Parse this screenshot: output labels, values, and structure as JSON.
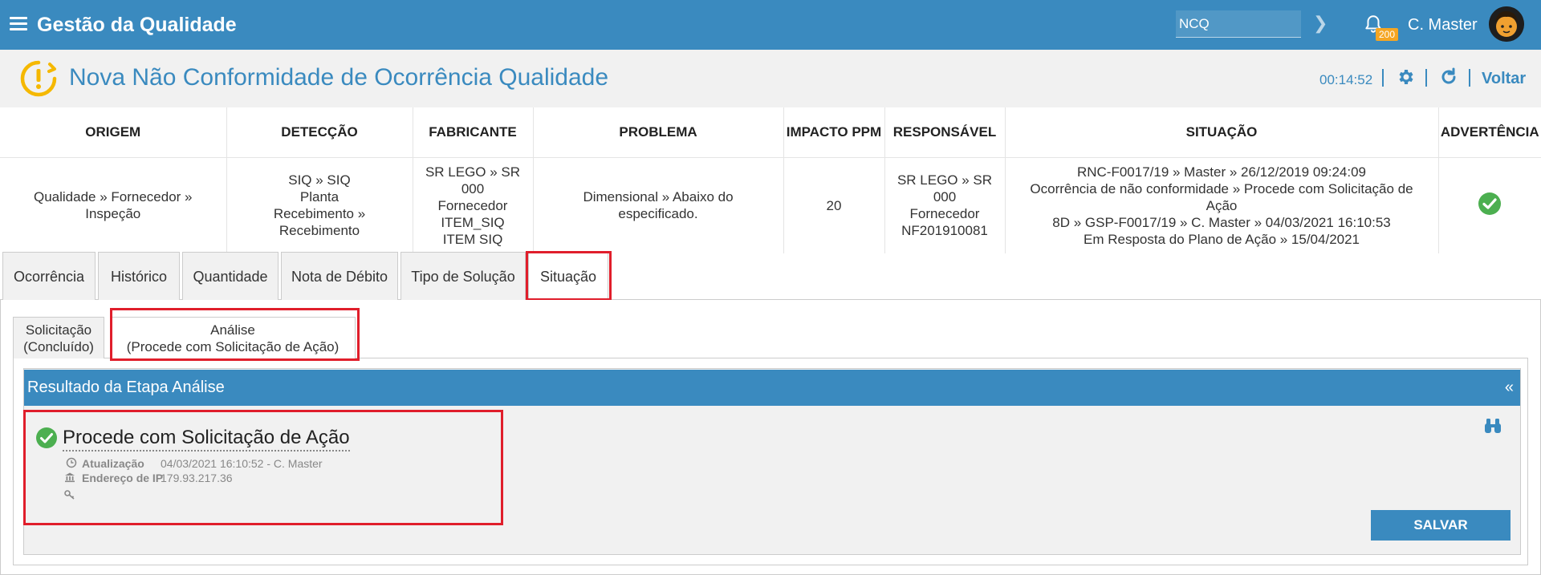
{
  "topbar": {
    "app_title": "Gestão da Qualidade",
    "search_value": "NCQ",
    "notification_count": "200",
    "user_name": "C. Master"
  },
  "page": {
    "title": "Nova Não Conformidade de Ocorrência Qualidade",
    "timer": "00:14:52",
    "back_label": "Voltar"
  },
  "summary": {
    "headers": [
      "ORIGEM",
      "DETECÇÃO",
      "FABRICANTE",
      "PROBLEMA",
      "IMPACTO PPM",
      "RESPONSÁVEL",
      "SITUAÇÃO",
      "ADVERTÊNCIA"
    ],
    "origem": [
      "Qualidade » Fornecedor »",
      "Inspeção"
    ],
    "deteccao": [
      "SIQ » SIQ",
      "Planta",
      "Recebimento »",
      "Recebimento"
    ],
    "fabricante": [
      "SR LEGO » SR",
      "000",
      "Fornecedor",
      "ITEM_SIQ",
      "ITEM SIQ"
    ],
    "problema": [
      "Dimensional » Abaixo do",
      "especificado."
    ],
    "impacto": "20",
    "responsavel": [
      "SR LEGO » SR",
      "000",
      "Fornecedor",
      "NF201910081"
    ],
    "situacao": [
      "RNC-F0017/19 » Master » 26/12/2019 09:24:09",
      "Ocorrência de não conformidade » Procede com Solicitação de",
      "Ação",
      "8D » GSP-F0017/19 » C. Master » 04/03/2021 16:10:53",
      "Em Resposta do Plano de Ação » 15/04/2021"
    ]
  },
  "tabs": [
    "Ocorrência",
    "Histórico",
    "Quantidade",
    "Nota de Débito",
    "Tipo de Solução",
    "Situação"
  ],
  "subtabs": {
    "solicitacao": [
      "Solicitação",
      "(Concluído)"
    ],
    "analise": [
      "Análise",
      "(Procede com Solicitação de Ação)"
    ]
  },
  "panel": {
    "header": "Resultado da Etapa Análise",
    "collapse": "«",
    "result_title": "Procede com Solicitação de Ação",
    "update_label": "Atualização",
    "update_value": "04/03/2021 16:10:52 - C. Master",
    "ip_label": "Endereço de IP",
    "ip_value": "179.93.217.36",
    "save_label": "SALVAR"
  },
  "colors": {
    "primary": "#3a8abf",
    "highlight": "#e01e2b",
    "success": "#4caf50",
    "warning": "#f5a623"
  }
}
